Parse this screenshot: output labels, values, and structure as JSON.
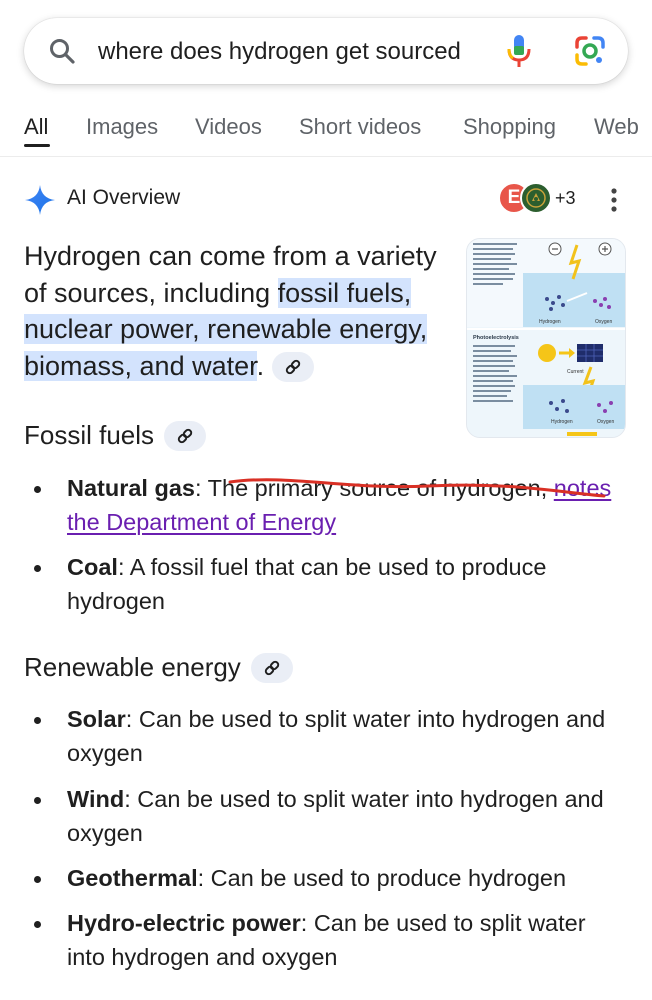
{
  "search": {
    "query": "where does hydrogen get sourced"
  },
  "tabs": [
    {
      "label": "All",
      "active": true
    },
    {
      "label": "Images"
    },
    {
      "label": "Videos"
    },
    {
      "label": "Short videos"
    },
    {
      "label": "Shopping"
    },
    {
      "label": "Web"
    }
  ],
  "ai_overview": {
    "title": "AI Overview",
    "avatar_letter": "E",
    "extra_sources": "+3",
    "summary": {
      "part1": "Hydrogen can come from a variety of sources, including ",
      "highlight": "fossil fuels, nuclear power, renewable ener­gy, biomass, and water",
      "part2": "."
    }
  },
  "sections": [
    {
      "heading": "Fossil fuels",
      "items": [
        {
          "term": "Natural gas",
          "sep": ": ",
          "text": "The primary source of hydrogen, ",
          "link": "notes the Department of Energy"
        },
        {
          "term": "Coal",
          "sep": ": ",
          "text": "A fossil fuel that can be used to produce hydrogen"
        }
      ]
    },
    {
      "heading": "Renewable energy",
      "items": [
        {
          "term": "Solar",
          "sep": ": ",
          "text": "Can be used to split water into hydrogen and oxygen"
        },
        {
          "term": "Wind",
          "sep": ": ",
          "text": "Can be used to split water into hydrogen and oxygen"
        },
        {
          "term": "Geothermal",
          "sep": ": ",
          "text": "Can be used to produce hydrogen"
        },
        {
          "term": "Hydro-electric power",
          "sep": ": ",
          "text": "Can be used to split water into hydrogen and oxygen"
        }
      ]
    }
  ],
  "thumbnail": {
    "top_label": "Hydrogen",
    "top_label2": "Oxygen",
    "mid_heading": "Photoelectrolysis",
    "bottom_label": "Hydrogen",
    "bottom_label2": "Oxygen",
    "current_label": "Current"
  },
  "colors": {
    "highlight": "#d3e3fd",
    "link_visited": "#6a1fb0",
    "annotation_red": "#d93025",
    "gemini_blue": "#4285f4"
  }
}
